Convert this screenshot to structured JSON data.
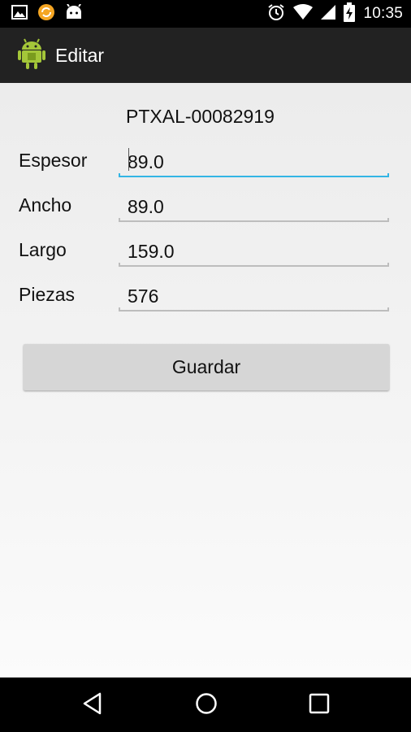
{
  "status_bar": {
    "time": "10:35",
    "left_icons": [
      "image-icon",
      "sync-icon",
      "android-notification-icon"
    ],
    "right_icons": [
      "alarm-icon",
      "wifi-icon",
      "signal-icon",
      "battery-charging-icon"
    ]
  },
  "action_bar": {
    "title": "Editar",
    "app_icon": "android-app-icon"
  },
  "form": {
    "record_id": "PTXAL-00082919",
    "fields": [
      {
        "label": "Espesor",
        "value": "89.0",
        "focused": true
      },
      {
        "label": "Ancho",
        "value": "89.0",
        "focused": false
      },
      {
        "label": "Largo",
        "value": "159.0",
        "focused": false
      },
      {
        "label": "Piezas",
        "value": "576",
        "focused": false
      }
    ],
    "save_label": "Guardar"
  },
  "nav_bar": {
    "buttons": [
      "back-icon",
      "home-icon",
      "recents-icon"
    ]
  },
  "colors": {
    "focus_accent": "#33b5e5",
    "action_bar": "#222222",
    "button": "#d6d6d6"
  }
}
